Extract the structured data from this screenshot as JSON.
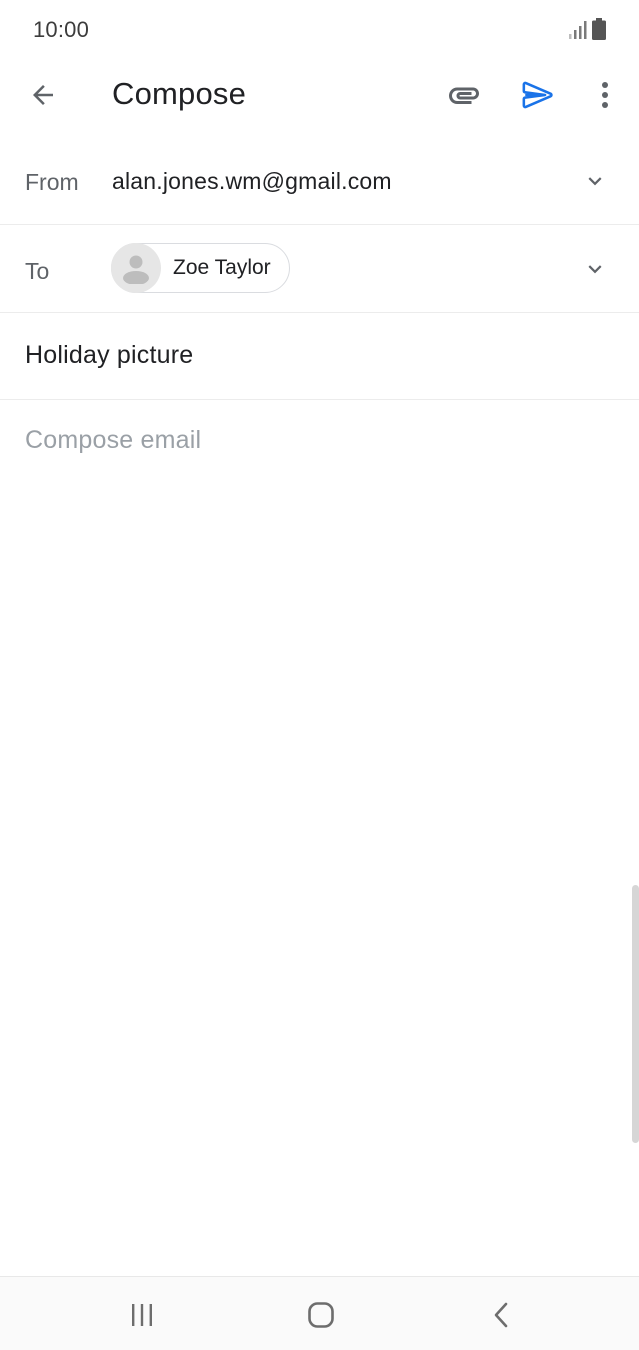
{
  "status_bar": {
    "time": "10:00",
    "signal_icon": "signal-icon",
    "battery_icon": "battery-icon"
  },
  "toolbar": {
    "back_icon": "arrow-back-icon",
    "title": "Compose",
    "attach_icon": "paperclip-icon",
    "send_icon": "send-icon",
    "more_icon": "more-vert-icon"
  },
  "from": {
    "label": "From",
    "value": "alan.jones.wm@gmail.com",
    "chevron_icon": "chevron-down-icon"
  },
  "to": {
    "label": "To",
    "recipients": [
      {
        "name": "Zoe Taylor",
        "avatar_icon": "person-icon"
      }
    ],
    "chevron_icon": "chevron-down-icon"
  },
  "subject": {
    "value": "Holiday picture"
  },
  "body": {
    "placeholder": "Compose email",
    "value": ""
  },
  "nav_bar": {
    "recents_icon": "recents-icon",
    "home_icon": "home-icon",
    "back_icon": "nav-back-icon"
  },
  "colors": {
    "accent": "#1a73e8",
    "text_primary": "#202124",
    "text_secondary": "#5f6368",
    "placeholder": "#9aa0a6",
    "divider": "#ececec"
  }
}
